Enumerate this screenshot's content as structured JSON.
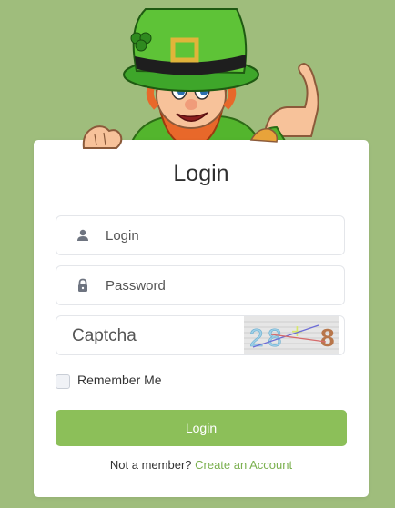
{
  "login_card": {
    "title": "Login",
    "login_field": {
      "placeholder": "Login",
      "icon": "user-icon"
    },
    "password_field": {
      "placeholder": "Password",
      "icon": "lock-icon"
    },
    "captcha_field": {
      "placeholder": "Captcha",
      "captcha_text": "28+8"
    },
    "remember_label": "Remember Me",
    "remember_checked": false,
    "submit_label": "Login",
    "footer_prompt": "Not a member?",
    "footer_link": "Create an Account"
  },
  "colors": {
    "background": "#9fbd7c",
    "accent": "#8cbf59",
    "link": "#7bb04f"
  },
  "mascot": "leprechaun-mascot"
}
